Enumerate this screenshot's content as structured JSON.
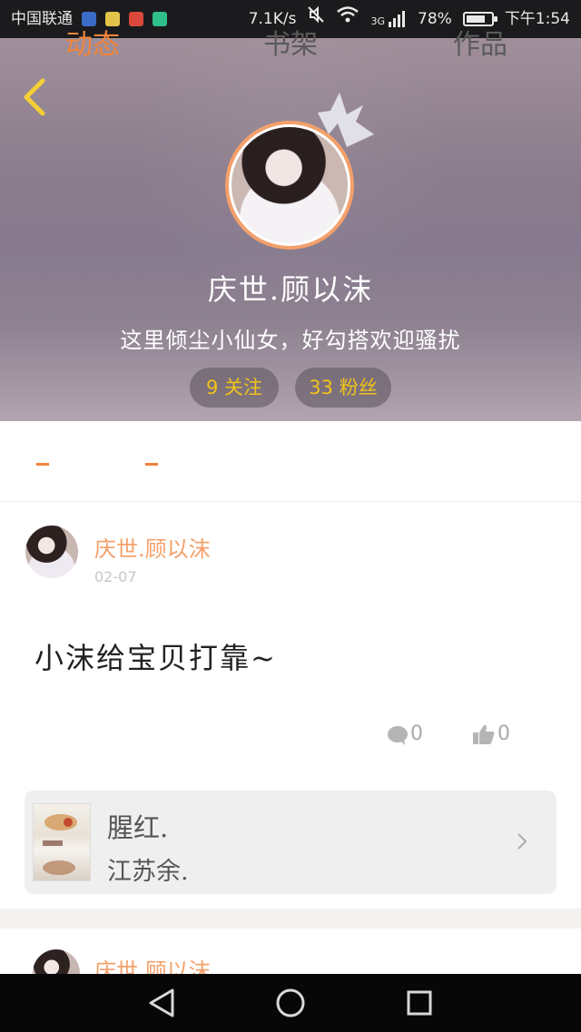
{
  "status_bar": {
    "carrier": "中国联通",
    "network_speed": "7.1K/s",
    "signal_type": "3G",
    "battery": "78%",
    "battery_level": 0.78,
    "time": "下午1:54"
  },
  "profile": {
    "name": "庆世.顾以沫",
    "bio": "这里倾尘小仙女，好勾搭欢迎骚扰",
    "following_label": "9 关注",
    "followers_label": "33 粉丝"
  },
  "tabs": [
    {
      "label": "动态",
      "active": true
    },
    {
      "label": "书架",
      "active": false
    },
    {
      "label": "作品",
      "active": false
    }
  ],
  "post": {
    "author": "庆世.顾以沫",
    "date": "02-07",
    "text": "小沫给宝贝打靠~",
    "comment_count": "0",
    "like_count": "0",
    "book": {
      "title": "腥红.",
      "author": "江苏余."
    }
  },
  "post2": {
    "author": "庆世.顾以沫"
  },
  "colors": {
    "accent": "#f0843c",
    "name_orange": "#f4a06b",
    "pill_text": "#f2c21a"
  }
}
